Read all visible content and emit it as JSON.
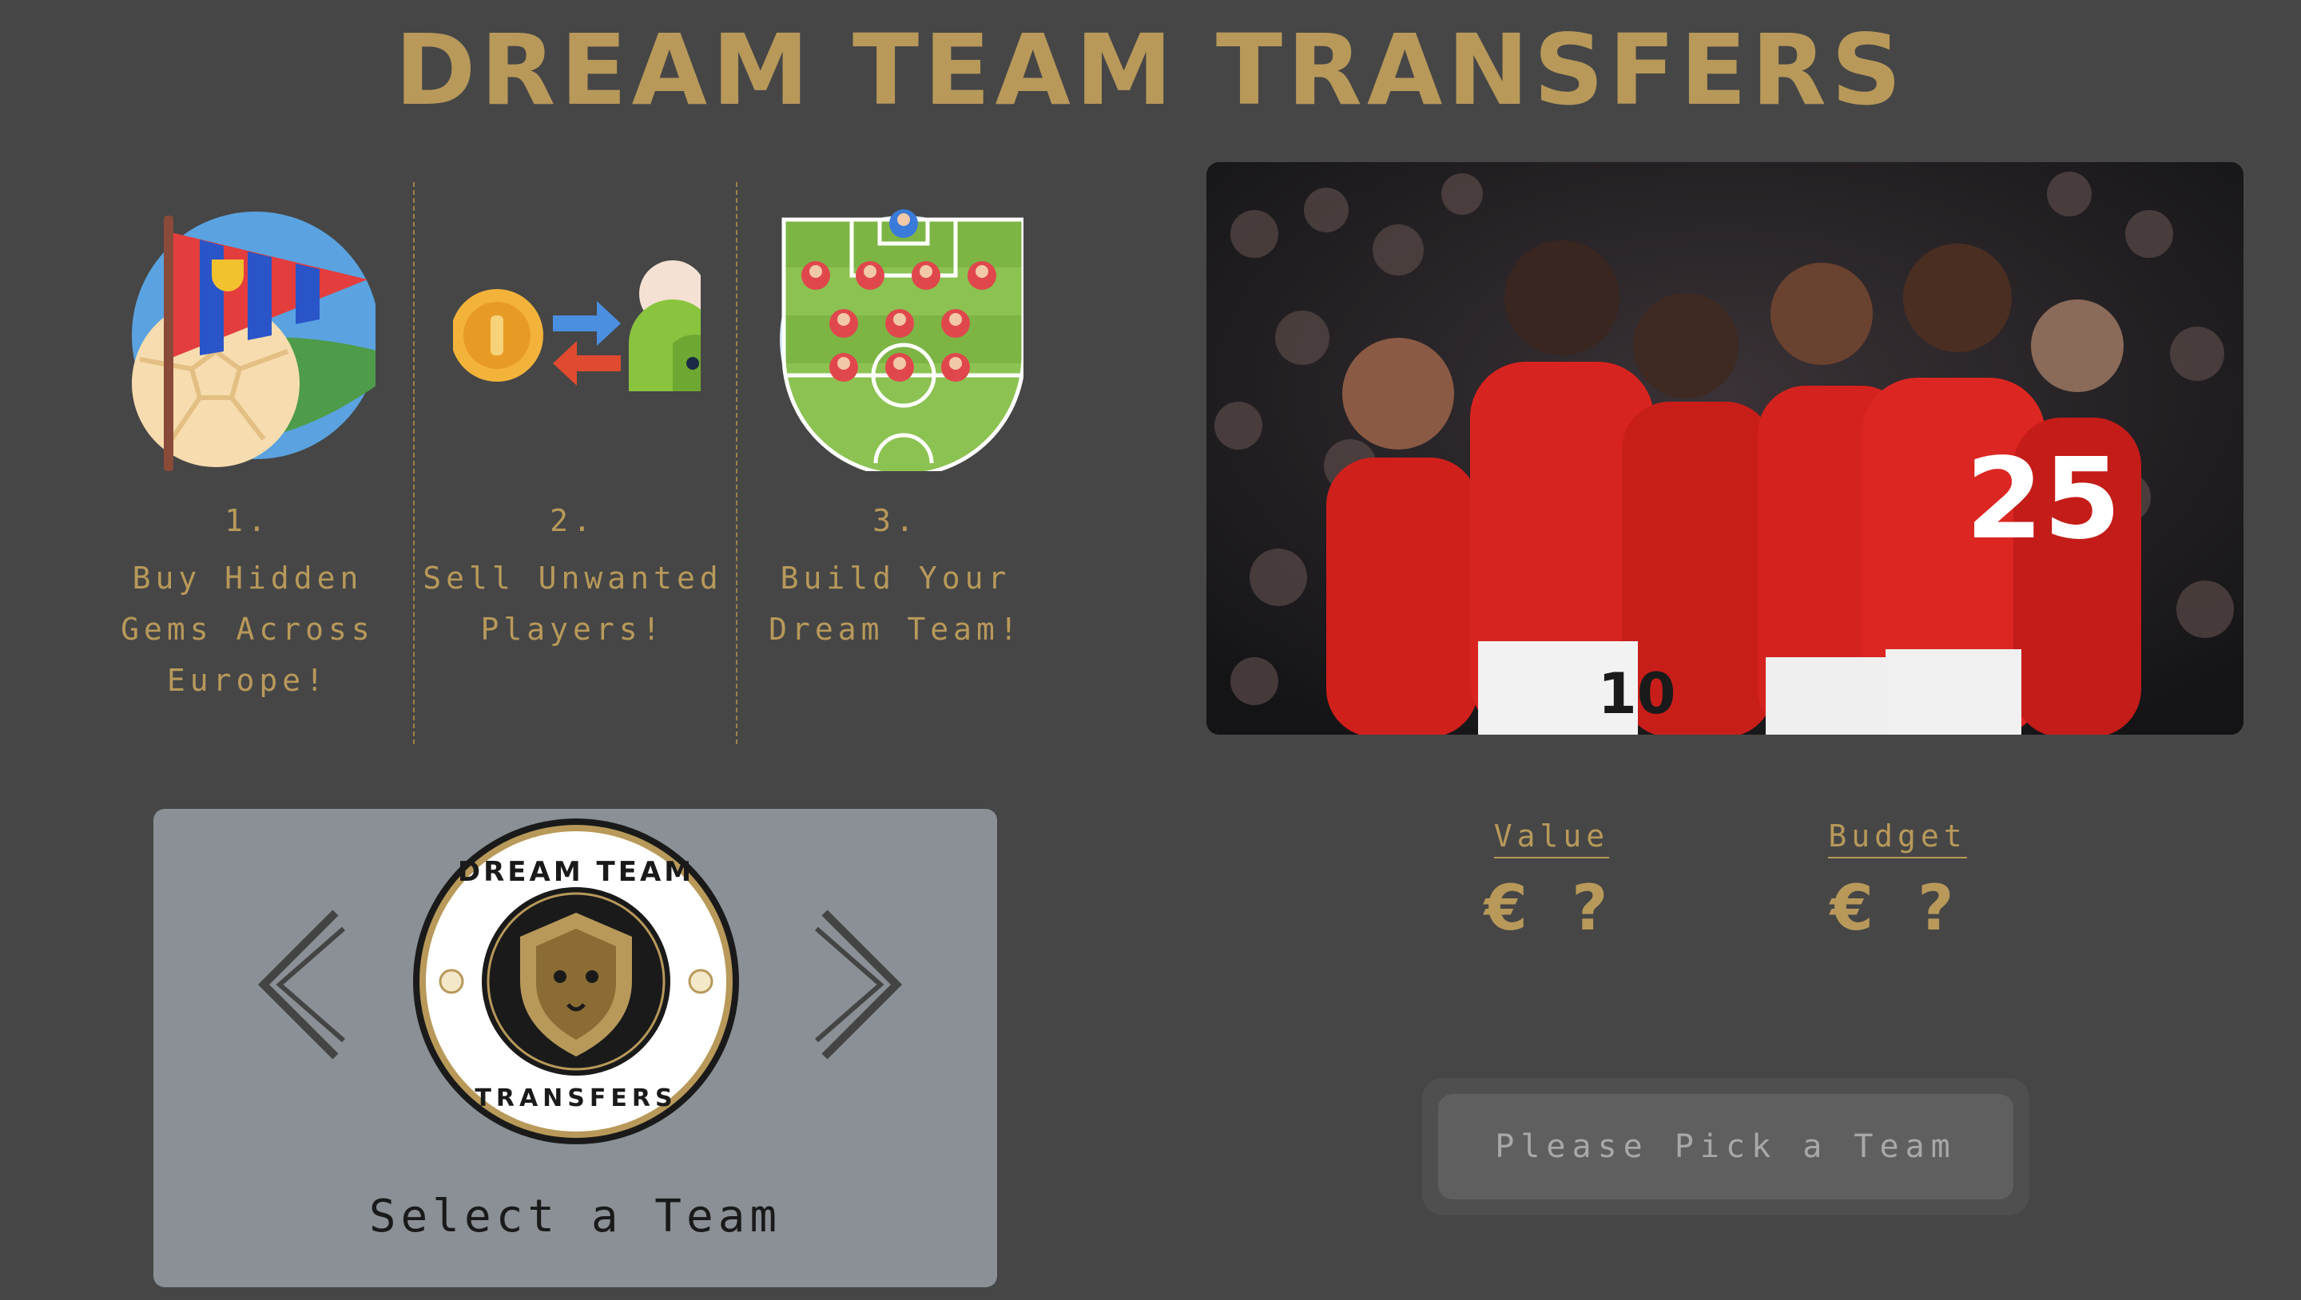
{
  "header": {
    "title": "DREAM TEAM TRANSFERS"
  },
  "steps": [
    {
      "number": "1.",
      "text_lines": [
        "Buy Hidden",
        "Gems Across",
        "Europe!"
      ],
      "icon": "pennant-football-icon"
    },
    {
      "number": "2.",
      "text_lines": [
        "Sell Unwanted",
        "Players!"
      ],
      "icon": "coin-exchange-icon"
    },
    {
      "number": "3.",
      "text_lines": [
        "Build Your",
        "Dream Team!"
      ],
      "icon": "football-pitch-lineup-icon"
    }
  ],
  "hero_image": {
    "description_icon": "team-celebration-photo"
  },
  "team_selector": {
    "badge_text_top": "DREAM TEAM",
    "badge_text_bottom": "TRANSFERS",
    "label": "Select a Team",
    "prev_icon": "chevron-left-icon",
    "next_icon": "chevron-right-icon"
  },
  "stats": {
    "value_label": "Value",
    "value": "€ ?",
    "budget_label": "Budget",
    "budget": "€ ?"
  },
  "action": {
    "button_label": "Please Pick a Team"
  },
  "colors": {
    "accent": "#b8995a",
    "background": "#464646",
    "panel": "#8a9095"
  }
}
